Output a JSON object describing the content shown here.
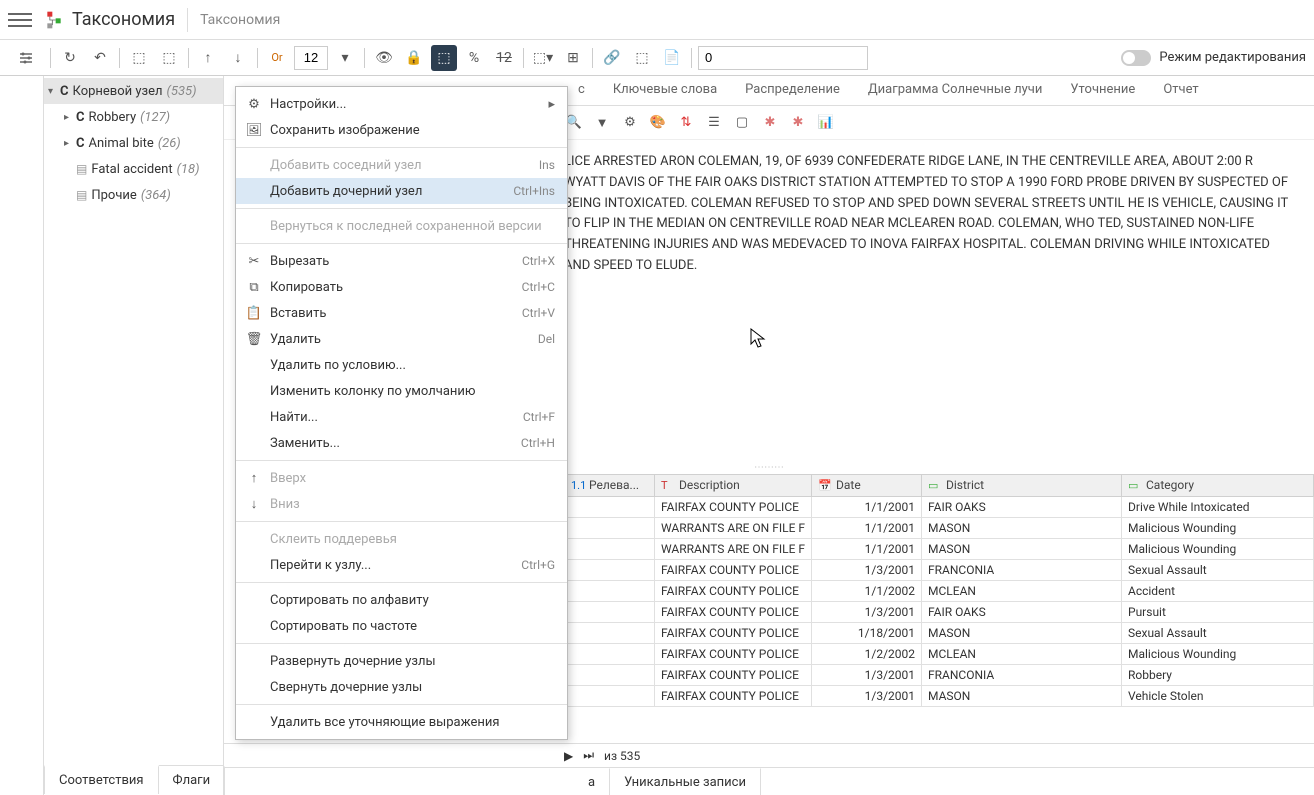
{
  "header": {
    "title": "Таксономия",
    "subtitle": "Таксономия"
  },
  "toolbar": {
    "font_size": "12",
    "num_input": "0",
    "edit_mode_label": "Режим редактирования",
    "or_label": "Or"
  },
  "tree": {
    "root": {
      "type": "C",
      "label": "Корневой узел",
      "count": "(535)"
    },
    "items": [
      {
        "type": "C",
        "label": "Robbery",
        "count": "(127)"
      },
      {
        "type": "C",
        "label": "Animal bite",
        "count": "(26)"
      },
      {
        "type": "doc",
        "label": "Fatal accident",
        "count": "(18)"
      },
      {
        "type": "doc",
        "label": "Прочие",
        "count": "(364)"
      }
    ]
  },
  "bottom_tabs": [
    "Соответствия",
    "Флаги"
  ],
  "content_tabs": [
    "с",
    "Ключевые слова",
    "Распределение",
    "Диаграмма Солнечные лучи",
    "Уточнение",
    "Отчет"
  ],
  "text_body": "LICE ARRESTED ARON COLEMAN, 19, OF 6939 CONFEDERATE RIDGE LANE, IN THE CENTREVILLE AREA, ABOUT 2:00 R WYATT DAVIS OF THE FAIR OAKS DISTRICT STATION ATTEMPTED TO STOP A 1990 FORD PROBE DRIVEN BY SUSPECTED OF BEING INTOXICATED. COLEMAN REFUSED TO STOP AND SPED DOWN SEVERAL STREETS UNTIL HE IS VEHICLE, CAUSING IT TO FLIP IN THE MEDIAN ON CENTREVILLE ROAD NEAR MCLEAREN ROAD. COLEMAN, WHO TED, SUSTAINED NON-LIFE THREATENING INJURIES AND WAS MEDEVACED TO INOVA FAIRFAX HOSPITAL. COLEMAN DRIVING WHILE INTOXICATED AND SPEED TO ELUDE.",
  "table": {
    "columns": [
      "Релева...",
      "Description",
      "Date",
      "District",
      "Category"
    ],
    "rows": [
      {
        "desc": "FAIRFAX COUNTY POLICE",
        "date": "1/1/2001",
        "district": "FAIR OAKS",
        "category": "Drive While Intoxicated"
      },
      {
        "desc": "WARRANTS ARE ON FILE F",
        "date": "1/1/2001",
        "district": "MASON",
        "category": "Malicious Wounding"
      },
      {
        "desc": "WARRANTS ARE ON FILE F",
        "date": "1/1/2001",
        "district": "MASON",
        "category": "Malicious Wounding"
      },
      {
        "desc": "FAIRFAX COUNTY POLICE",
        "date": "1/3/2001",
        "district": "FRANCONIA",
        "category": "Sexual Assault"
      },
      {
        "desc": "FAIRFAX COUNTY POLICE",
        "date": "1/1/2002",
        "district": "MCLEAN",
        "category": "Accident"
      },
      {
        "desc": "FAIRFAX COUNTY POLICE",
        "date": "1/3/2001",
        "district": "FAIR OAKS",
        "category": "Pursuit"
      },
      {
        "desc": "FAIRFAX COUNTY POLICE",
        "date": "1/18/2001",
        "district": "MASON",
        "category": "Sexual Assault"
      },
      {
        "desc": "FAIRFAX COUNTY POLICE",
        "date": "1/2/2002",
        "district": "MCLEAN",
        "category": "Malicious Wounding"
      },
      {
        "desc": "FAIRFAX COUNTY POLICE",
        "date": "1/3/2001",
        "district": "FRANCONIA",
        "category": "Robbery"
      },
      {
        "desc": "FAIRFAX COUNTY POLICE",
        "date": "1/3/2001",
        "district": "MASON",
        "category": "Vehicle Stolen"
      }
    ]
  },
  "pager": {
    "of_text": "из 535"
  },
  "content_bottom_tabs": [
    "а",
    "Уникальные записи"
  ],
  "context_menu": {
    "groups": [
      [
        {
          "icon": "settings",
          "label": "Настройки...",
          "arrow": true
        },
        {
          "icon": "save",
          "label": "Сохранить изображение"
        }
      ],
      [
        {
          "label": "Добавить соседний узел",
          "shortcut": "Ins",
          "disabled": true
        },
        {
          "label": "Добавить дочерний узел",
          "shortcut": "Ctrl+Ins",
          "highlighted": true
        }
      ],
      [
        {
          "label": "Вернуться к последней сохраненной версии",
          "disabled": true
        }
      ],
      [
        {
          "icon": "cut",
          "label": "Вырезать",
          "shortcut": "Ctrl+X"
        },
        {
          "icon": "copy",
          "label": "Копировать",
          "shortcut": "Ctrl+C"
        },
        {
          "icon": "paste",
          "label": "Вставить",
          "shortcut": "Ctrl+V"
        },
        {
          "icon": "delete",
          "label": "Удалить",
          "shortcut": "Del"
        },
        {
          "label": "Удалить по условию..."
        },
        {
          "label": "Изменить колонку по умолчанию"
        },
        {
          "label": "Найти...",
          "shortcut": "Ctrl+F"
        },
        {
          "label": "Заменить...",
          "shortcut": "Ctrl+H"
        }
      ],
      [
        {
          "icon": "up",
          "label": "Вверх",
          "disabled": true
        },
        {
          "icon": "down",
          "label": "Вниз",
          "disabled": true
        }
      ],
      [
        {
          "label": "Склеить поддеревья",
          "disabled": true
        },
        {
          "label": "Перейти к узлу...",
          "shortcut": "Ctrl+G"
        }
      ],
      [
        {
          "label": "Сортировать по алфавиту"
        },
        {
          "label": "Сортировать по частоте"
        }
      ],
      [
        {
          "label": "Развернуть дочерние узлы"
        },
        {
          "label": "Свернуть дочерние узлы"
        }
      ],
      [
        {
          "label": "Удалить все уточняющие выражения"
        }
      ]
    ]
  }
}
